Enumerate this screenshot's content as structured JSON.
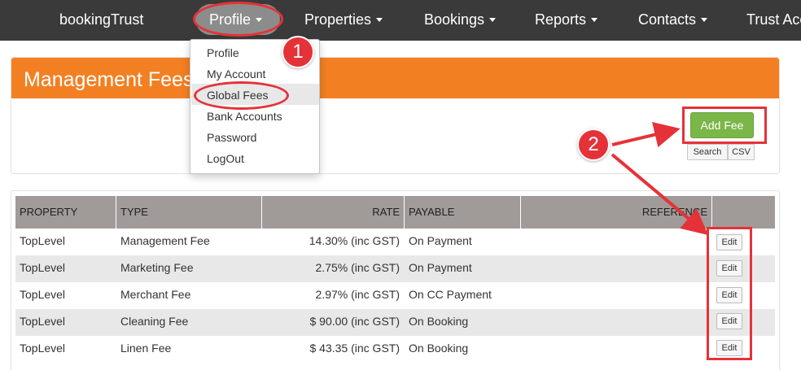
{
  "navbar": {
    "brand": "bookingTrust",
    "items": [
      {
        "label": "Profile"
      },
      {
        "label": "Properties"
      },
      {
        "label": "Bookings"
      },
      {
        "label": "Reports"
      },
      {
        "label": "Contacts"
      },
      {
        "label": "Trust Acc"
      }
    ]
  },
  "profile_menu": {
    "items": [
      "Profile",
      "My Account",
      "Global Fees",
      "Bank Accounts",
      "Password",
      "LogOut"
    ]
  },
  "panel": {
    "title": "Management Fees",
    "add_fee_label": "Add Fee",
    "search_label": "Search",
    "csv_label": "CSV"
  },
  "table": {
    "headers": [
      "PROPERTY",
      "TYPE",
      "RATE",
      "PAYABLE",
      "REFERENCE",
      ""
    ],
    "rows": [
      {
        "property": "TopLevel",
        "type": "Management Fee",
        "rate": "14.30% (inc GST)",
        "payable": "On Payment",
        "action": "Edit"
      },
      {
        "property": "TopLevel",
        "type": "Marketing Fee",
        "rate": "2.75% (inc GST)",
        "payable": "On Payment",
        "action": "Edit"
      },
      {
        "property": "TopLevel",
        "type": "Merchant Fee",
        "rate": "2.97% (inc GST)",
        "payable": "On CC Payment",
        "action": "Edit"
      },
      {
        "property": "TopLevel",
        "type": "Cleaning Fee",
        "rate": "$ 90.00 (inc GST)",
        "payable": "On Booking",
        "action": "Edit"
      },
      {
        "property": "TopLevel",
        "type": "Linen Fee",
        "rate": "$ 43.35 (inc GST)",
        "payable": "On Booking",
        "action": "Edit"
      }
    ]
  },
  "annotations": {
    "step1": "1",
    "step2": "2",
    "color": "#e53238"
  },
  "colors": {
    "navbar": "#3a3a3a",
    "panel_header": "#f28022",
    "add_button": "#7ab648",
    "table_header": "#a09a98"
  }
}
